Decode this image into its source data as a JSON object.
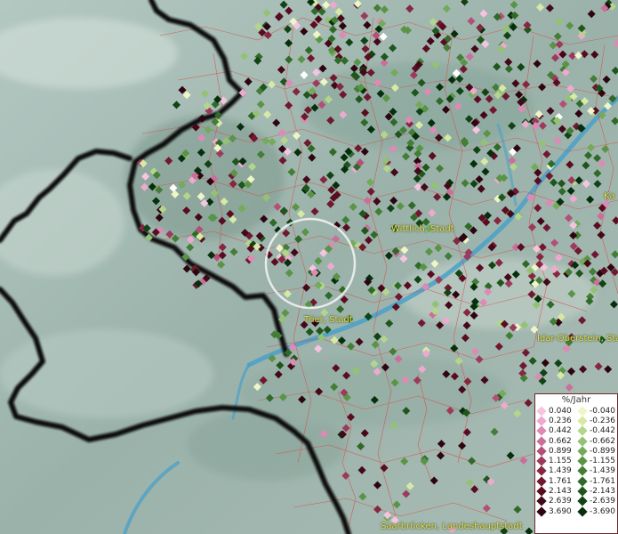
{
  "legend": {
    "title": "%/Jahr",
    "positive": [
      {
        "label": "0.040",
        "color": "#f7c4e0"
      },
      {
        "label": "0.236",
        "color": "#eeaace"
      },
      {
        "label": "0.442",
        "color": "#de8ab4"
      },
      {
        "label": "0.662",
        "color": "#cc6e9a"
      },
      {
        "label": "0.899",
        "color": "#b45078"
      },
      {
        "label": "1.155",
        "color": "#9c3a5c"
      },
      {
        "label": "1.439",
        "color": "#862640"
      },
      {
        "label": "1.761",
        "color": "#701830"
      },
      {
        "label": "2.143",
        "color": "#5a0c20"
      },
      {
        "label": "2.639",
        "color": "#440818"
      },
      {
        "label": "3.690",
        "color": "#2e0410"
      }
    ],
    "negative": [
      {
        "label": "-0.040",
        "color": "#eef5c6"
      },
      {
        "label": "-0.236",
        "color": "#d6eaa6"
      },
      {
        "label": "-0.442",
        "color": "#b4d68a"
      },
      {
        "label": "-0.662",
        "color": "#94c274"
      },
      {
        "label": "-0.899",
        "color": "#74aa5a"
      },
      {
        "label": "-1.155",
        "color": "#5a9446"
      },
      {
        "label": "-1.439",
        "color": "#447e36"
      },
      {
        "label": "-1.761",
        "color": "#306a28"
      },
      {
        "label": "-2.143",
        "color": "#1e561c"
      },
      {
        "label": "-2.639",
        "color": "#104414"
      },
      {
        "label": "-3.690",
        "color": "#06300c"
      }
    ]
  },
  "cities": {
    "wittlich": "Wittlich, Stadt",
    "trier": "Trier, Stadt",
    "idar": "Idar-Oberstein, Sta",
    "saarbruecken": "Saarbrücken, Landeshauptstadt",
    "kaiser": "Ka"
  },
  "colors": {
    "white_point": "#ffffff",
    "river": "#4aa0c8",
    "border": "#111111",
    "admin_lines": "#e04040"
  }
}
